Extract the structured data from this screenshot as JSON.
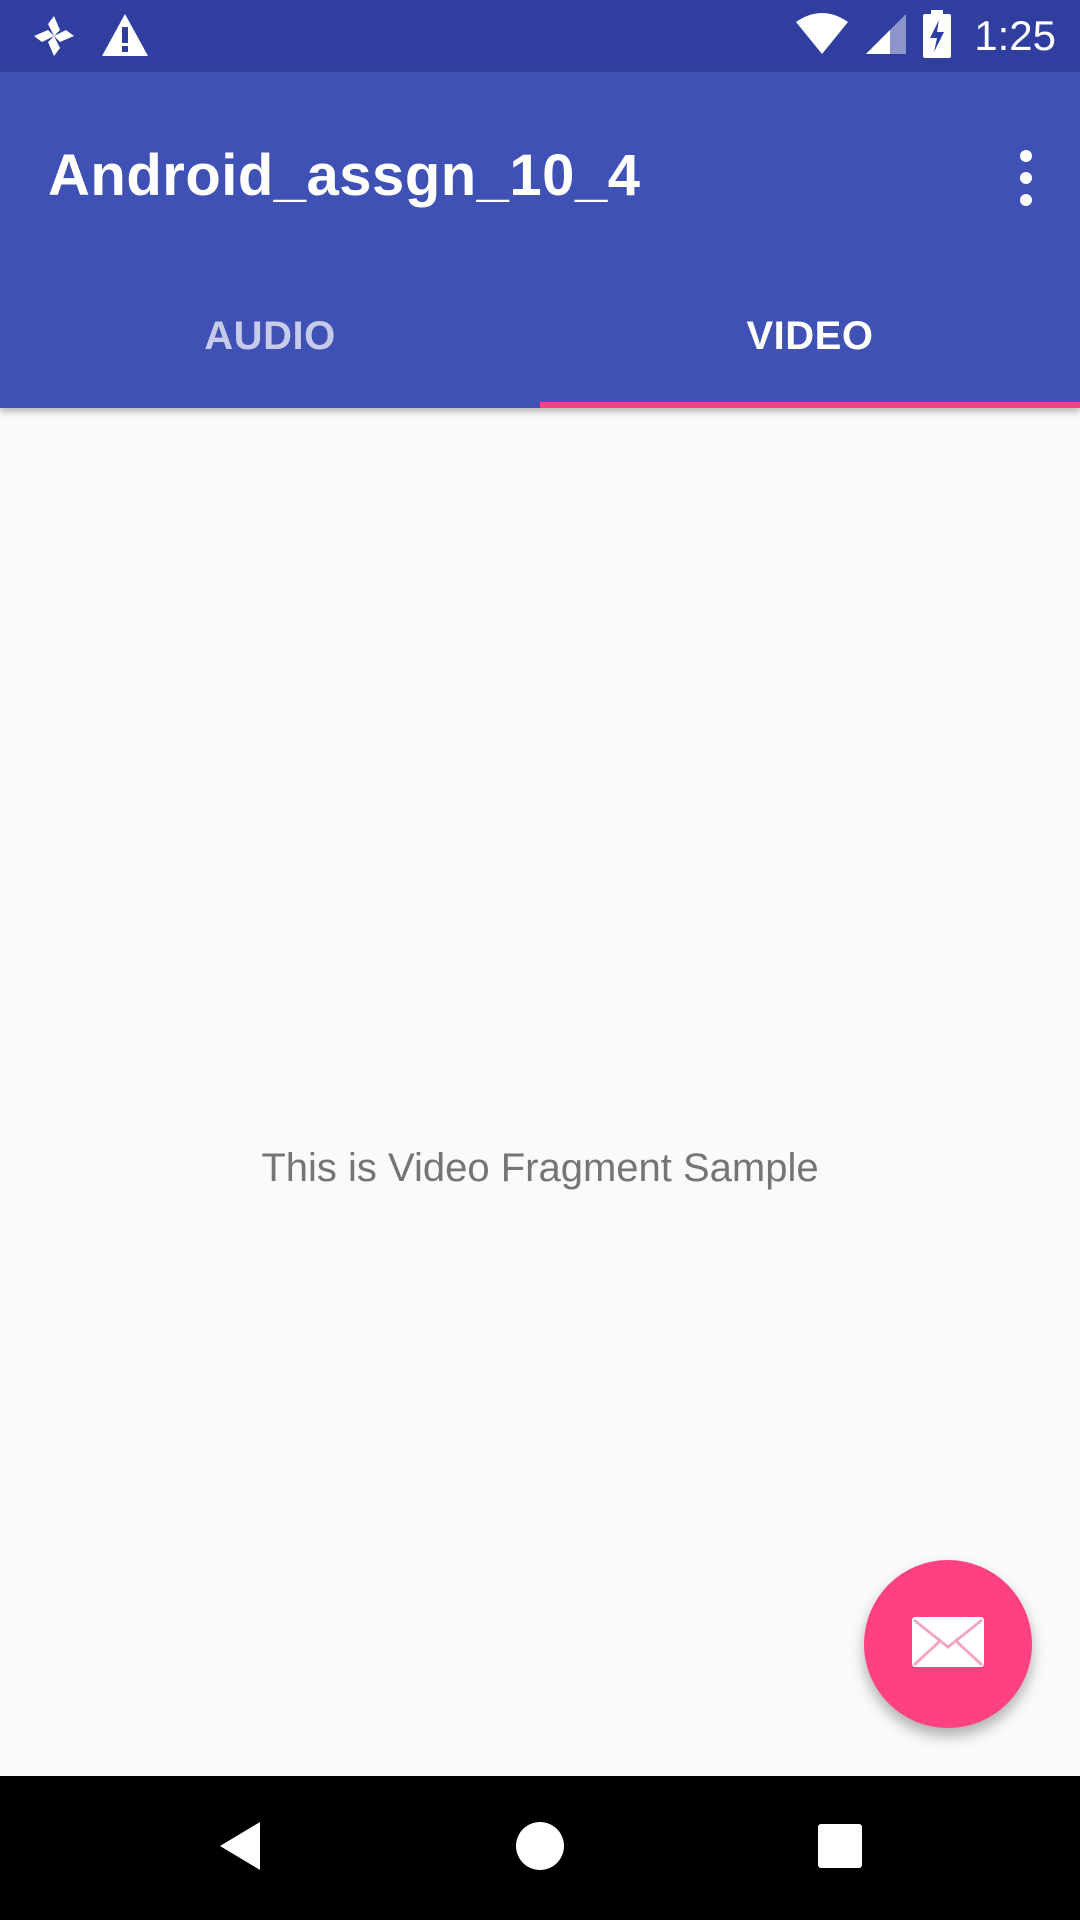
{
  "status_bar": {
    "time": "1:25",
    "left_icons": [
      "pinwheel-icon",
      "warning-icon"
    ],
    "right_icons": [
      "wifi-icon",
      "signal-icon",
      "battery-charging-icon"
    ]
  },
  "app_bar": {
    "title": "Android_assgn_10_4",
    "menu_icon": "more-vert-icon"
  },
  "tabs": [
    {
      "label": "AUDIO",
      "selected": false
    },
    {
      "label": "VIDEO",
      "selected": true
    }
  ],
  "content": {
    "message": "This is Video Fragment Sample"
  },
  "fab": {
    "icon": "email-icon"
  },
  "nav_bar": {
    "icons": [
      "back-icon",
      "home-icon",
      "recents-icon"
    ]
  },
  "colors": {
    "status_bar": "#303f9f",
    "primary": "#3f51b5",
    "accent": "#ff4081",
    "background": "#fafafa",
    "body_text": "#757575"
  }
}
